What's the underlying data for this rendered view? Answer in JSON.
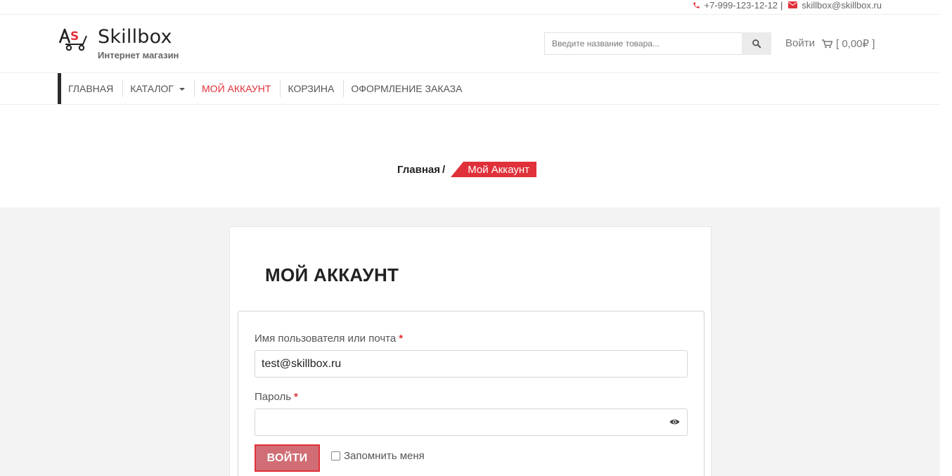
{
  "topbar": {
    "phone": "+7-999-123-12-12",
    "separator": "|",
    "email": "skillbox@skillbox.ru",
    "phone_icon": "phone-icon",
    "mail_icon": "envelope-icon"
  },
  "header": {
    "brand": "Skillbox",
    "tagline": "Интернет магазин",
    "logo_icon": "skillbox-logo",
    "search": {
      "placeholder": "Введите название товара...",
      "button_icon": "search-icon"
    },
    "login_label": "Войти",
    "cart_label": "[ 0,00₽ ]",
    "cart_icon": "cart-icon"
  },
  "nav": {
    "items": [
      {
        "label": "ГЛАВНАЯ",
        "active": false
      },
      {
        "label": "КАТАЛОГ",
        "active": false,
        "dropdown": true
      },
      {
        "label": "МОЙ АККАУНТ",
        "active": true
      },
      {
        "label": "КОРЗИНА",
        "active": false
      },
      {
        "label": "ОФОРМЛЕНИЕ ЗАКАЗА",
        "active": false
      }
    ]
  },
  "breadcrumb": {
    "home": "Главная",
    "slash": "/",
    "current": "Мой Аккаунт"
  },
  "account": {
    "title": "МОЙ АККАУНТ",
    "username_label": "Имя пользователя или почта",
    "username_value": "test@skillbox.ru",
    "password_label": "Пароль",
    "password_value": "",
    "required_mark": "*",
    "login_button": "ВОЙТИ",
    "remember_label": "Запомнить меня",
    "remember_checked": false
  },
  "colors": {
    "accent": "#e0313a",
    "button_fill": "#d16d74",
    "content_bg": "#f3f3f3"
  }
}
